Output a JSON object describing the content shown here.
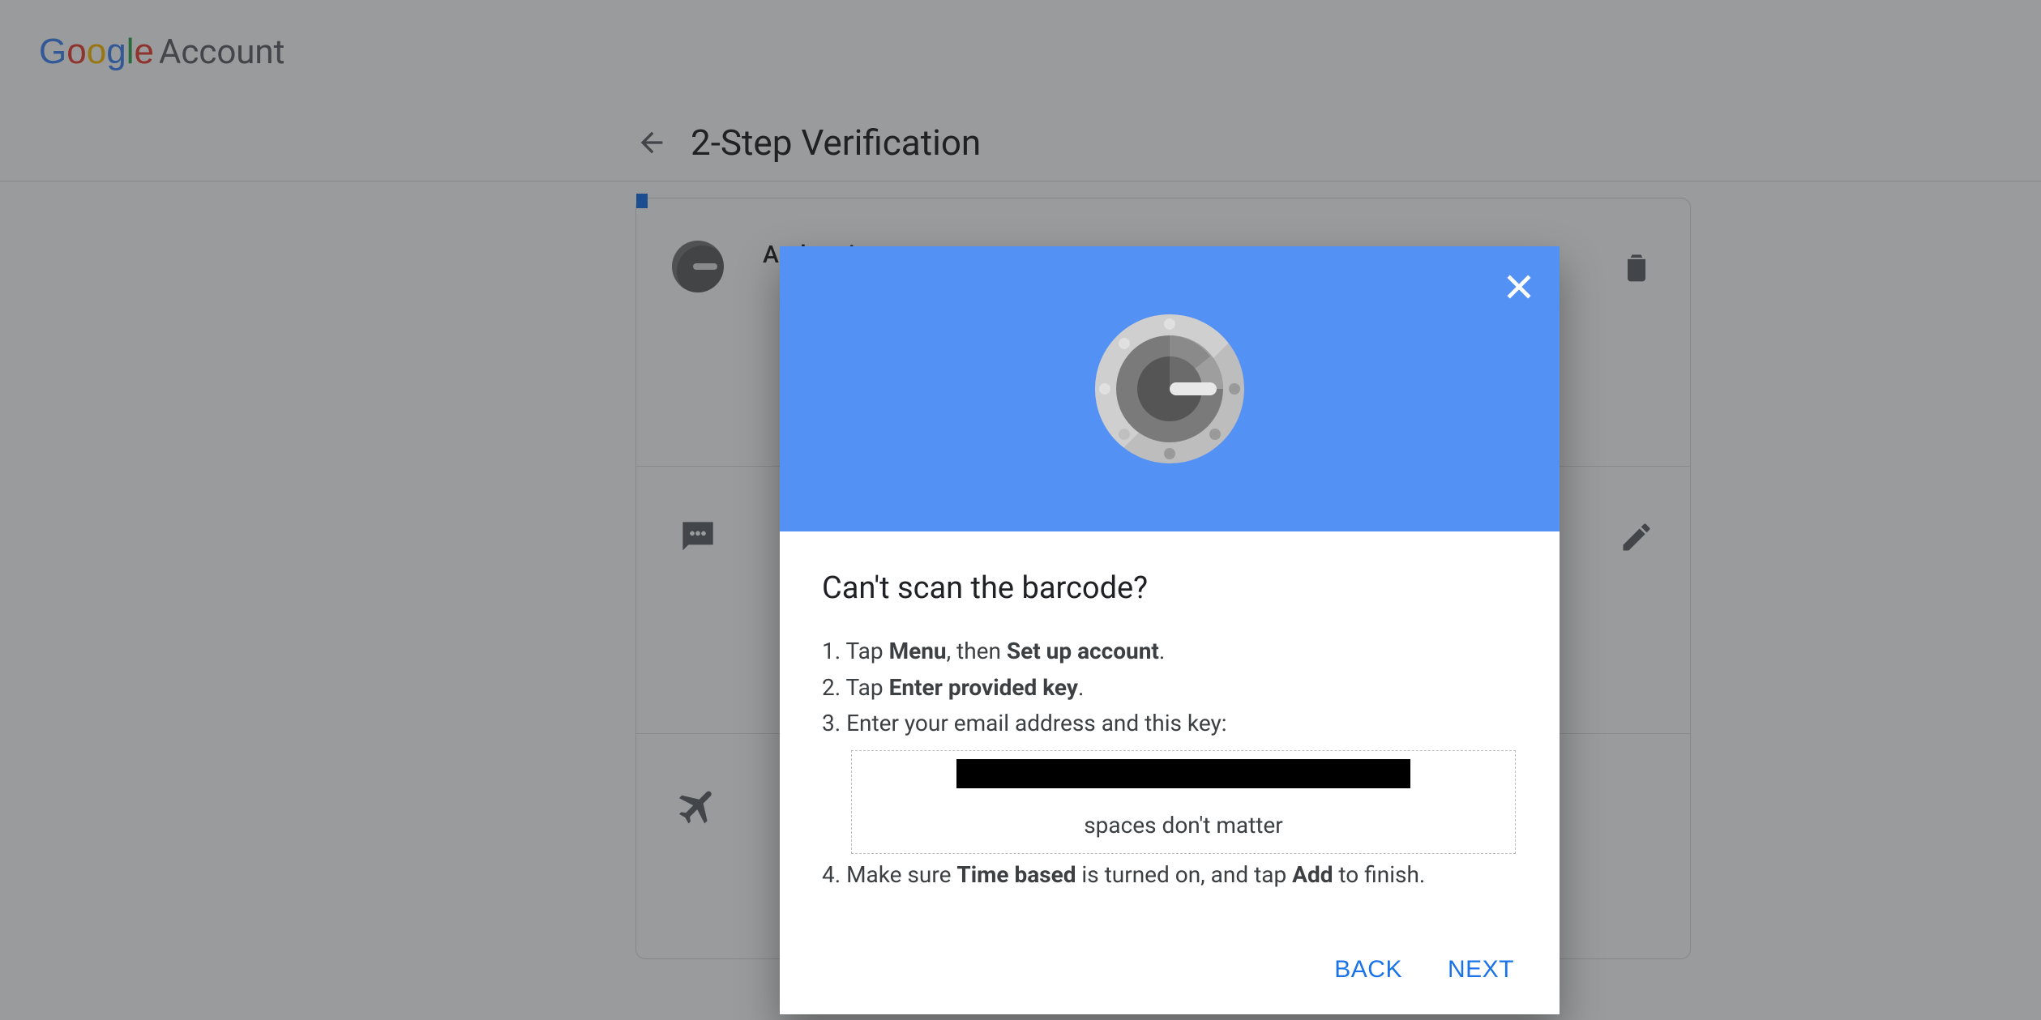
{
  "header": {
    "logo_letters": [
      "G",
      "o",
      "o",
      "g",
      "l",
      "e"
    ],
    "account_label": "Account"
  },
  "section": {
    "title": "2-Step Verification"
  },
  "card": {
    "rows": [
      {
        "label": "Authenticator app",
        "icon": "authenticator",
        "action": "delete"
      },
      {
        "label": "",
        "icon": "sms",
        "action": "edit"
      },
      {
        "label": "",
        "icon": "plane",
        "action": ""
      }
    ]
  },
  "modal": {
    "title": "Can't scan the barcode?",
    "step1_a": "1. Tap ",
    "step1_b": "Menu",
    "step1_c": ", then ",
    "step1_d": "Set up account",
    "step1_e": ".",
    "step2_a": "2. Tap ",
    "step2_b": "Enter provided key",
    "step2_c": ".",
    "step3": "3. Enter your email address and this key:",
    "key_note": "spaces don't matter",
    "step4_a": "4. Make sure ",
    "step4_b": "Time based",
    "step4_c": " is turned on, and tap ",
    "step4_d": "Add",
    "step4_e": " to finish.",
    "back": "BACK",
    "next": "NEXT"
  }
}
